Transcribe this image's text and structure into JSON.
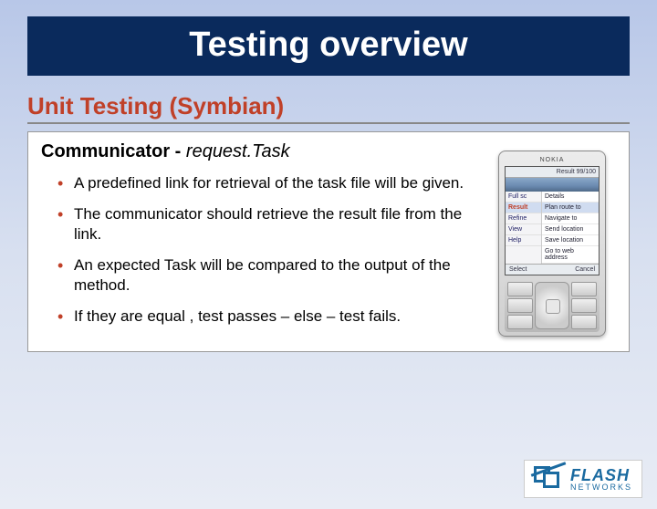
{
  "title": "Testing overview",
  "subtitle": "Unit Testing (Symbian)",
  "communicator": {
    "label": "Communicator",
    "sep": " - ",
    "method": "request.Task"
  },
  "bullets": [
    "A predefined link for retrieval of the task file will be given.",
    "The communicator should retrieve the result file from the link.",
    "An expected Task will be compared to the output of the method.",
    "If they are equal , test passes – else – test fails."
  ],
  "phone": {
    "brand": "NOKIA",
    "header": "Result 99/100",
    "left_menu": [
      "Full sc",
      "Result",
      "Refine",
      "View",
      "Help"
    ],
    "left_hl_index": 1,
    "right_menu": [
      "Details",
      "Plan route to",
      "Navigate to",
      "Send location",
      "Save location",
      "Go to web address"
    ],
    "right_hl_index": 1,
    "softkeys": {
      "left": "Select",
      "right": "Cancel"
    }
  },
  "logo": {
    "line1": "FLASH",
    "line2": "NETWORKS"
  }
}
